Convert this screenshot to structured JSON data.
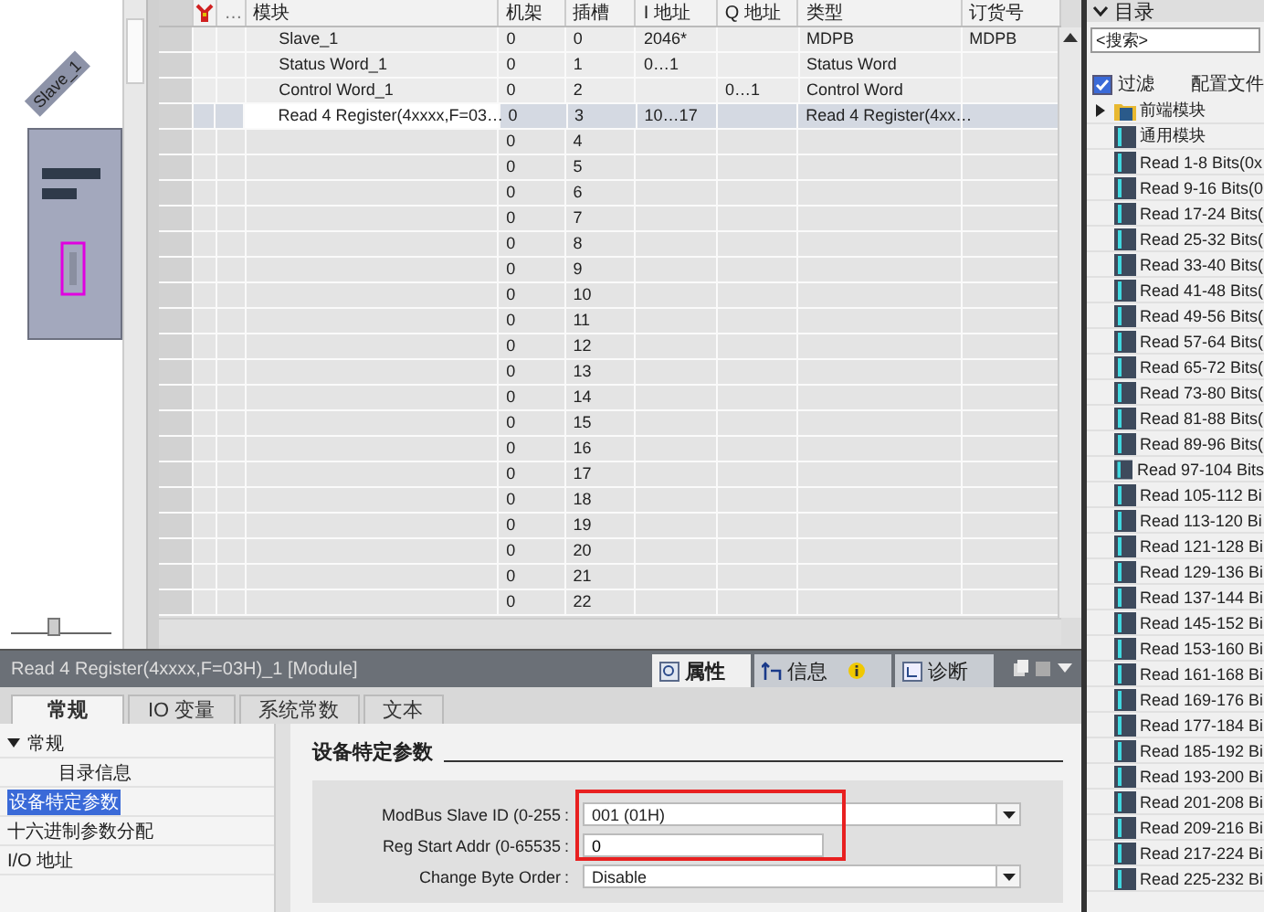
{
  "device_view": {
    "label": "Slave_1",
    "zoom": {
      "level": 0.4
    }
  },
  "table": {
    "columns": [
      "…",
      "模块",
      "机架",
      "插槽",
      "I 地址",
      "Q 地址",
      "类型",
      "订货号"
    ],
    "rows": [
      {
        "module": "Slave_1",
        "rack": "0",
        "slot": "0",
        "i_address": "2046*",
        "type": "MDPB",
        "order_no": "MDPB",
        "selected": false
      },
      {
        "module": "Status Word_1",
        "rack": "0",
        "slot": "1",
        "i_address": "0…1",
        "type": "Status Word",
        "selected": false
      },
      {
        "module": "Control Word_1",
        "rack": "0",
        "slot": "2",
        "q_address": "0…1",
        "type": "Control Word",
        "selected": false
      },
      {
        "module": "Read 4 Register(4xxxx,F=03…",
        "rack": "0",
        "slot": "3",
        "i_address": "10…17",
        "type": "Read 4 Register(4xx…",
        "selected": true
      },
      {
        "rack": "0",
        "slot": "4",
        "selected": false
      },
      {
        "rack": "0",
        "slot": "5",
        "selected": false
      },
      {
        "rack": "0",
        "slot": "6",
        "selected": false
      },
      {
        "rack": "0",
        "slot": "7",
        "selected": false
      },
      {
        "rack": "0",
        "slot": "8",
        "selected": false
      },
      {
        "rack": "0",
        "slot": "9",
        "selected": false
      },
      {
        "rack": "0",
        "slot": "10",
        "selected": false
      },
      {
        "rack": "0",
        "slot": "11",
        "selected": false
      },
      {
        "rack": "0",
        "slot": "12",
        "selected": false
      },
      {
        "rack": "0",
        "slot": "13",
        "selected": false
      },
      {
        "rack": "0",
        "slot": "14",
        "selected": false
      },
      {
        "rack": "0",
        "slot": "15",
        "selected": false
      },
      {
        "rack": "0",
        "slot": "16",
        "selected": false
      },
      {
        "rack": "0",
        "slot": "17",
        "selected": false
      },
      {
        "rack": "0",
        "slot": "18",
        "selected": false
      },
      {
        "rack": "0",
        "slot": "19",
        "selected": false
      },
      {
        "rack": "0",
        "slot": "20",
        "selected": false
      },
      {
        "rack": "0",
        "slot": "21",
        "selected": false
      },
      {
        "rack": "0",
        "slot": "22",
        "selected": false
      }
    ]
  },
  "properties": {
    "title": "Read 4 Register(4xxxx,F=03H)_1 [Module]",
    "view_tabs": [
      {
        "label": "属性",
        "kind": "properties",
        "selected": true
      },
      {
        "label": "信息",
        "kind": "info",
        "selected": false
      },
      {
        "label": "诊断",
        "kind": "diagnostics",
        "selected": false
      }
    ],
    "tabs": [
      {
        "label": "常规",
        "selected": true
      },
      {
        "label": "IO 变量",
        "selected": false
      },
      {
        "label": "系统常数",
        "selected": false
      },
      {
        "label": "文本",
        "selected": false
      }
    ],
    "nav": [
      {
        "label": "常规",
        "expanded": true,
        "selected": false,
        "children": [
          {
            "label": "目录信息",
            "selected": false
          }
        ]
      },
      {
        "label": "设备特定参数",
        "selected": true
      },
      {
        "label": "十六进制参数分配",
        "selected": false
      },
      {
        "label": "I/O 地址",
        "selected": false
      }
    ],
    "section_title": "设备特定参数",
    "highlight_box": true,
    "fields": [
      {
        "label": "ModBus Slave ID (0-255",
        "colon": ":",
        "kind": "dropdown",
        "value": "001 (01H)"
      },
      {
        "label": "Reg Start Addr (0-65535",
        "colon": ":",
        "kind": "input",
        "value": "0"
      },
      {
        "label": "Change Byte Order",
        "colon": ":",
        "kind": "dropdown",
        "value": "Disable"
      }
    ]
  },
  "catalog": {
    "title": "目录",
    "search": {
      "placeholder": "<搜索>"
    },
    "filter": {
      "label": "过滤",
      "checked": true
    },
    "profile_label": "配置文件",
    "items": [
      {
        "label": "前端模块",
        "kind": "folder",
        "expanded": false
      },
      {
        "label": "通用模块",
        "kind": "module"
      },
      {
        "label": "Read 1-8 Bits(0x",
        "kind": "module"
      },
      {
        "label": "Read 9-16 Bits(0",
        "kind": "module"
      },
      {
        "label": "Read 17-24 Bits(",
        "kind": "module"
      },
      {
        "label": "Read 25-32 Bits(",
        "kind": "module"
      },
      {
        "label": "Read 33-40 Bits(",
        "kind": "module"
      },
      {
        "label": "Read 41-48 Bits(",
        "kind": "module"
      },
      {
        "label": "Read 49-56 Bits(",
        "kind": "module"
      },
      {
        "label": "Read 57-64 Bits(",
        "kind": "module"
      },
      {
        "label": "Read 65-72 Bits(",
        "kind": "module"
      },
      {
        "label": "Read 73-80 Bits(",
        "kind": "module"
      },
      {
        "label": "Read 81-88 Bits(",
        "kind": "module"
      },
      {
        "label": "Read 89-96 Bits(",
        "kind": "module"
      },
      {
        "label": "Read 97-104 Bits",
        "kind": "module"
      },
      {
        "label": "Read 105-112 Bi",
        "kind": "module"
      },
      {
        "label": "Read 113-120 Bi",
        "kind": "module"
      },
      {
        "label": "Read 121-128 Bi",
        "kind": "module"
      },
      {
        "label": "Read 129-136 Bi",
        "kind": "module"
      },
      {
        "label": "Read 137-144 Bi",
        "kind": "module"
      },
      {
        "label": "Read 145-152 Bi",
        "kind": "module"
      },
      {
        "label": "Read 153-160 Bi",
        "kind": "module"
      },
      {
        "label": "Read 161-168 Bi",
        "kind": "module"
      },
      {
        "label": "Read 169-176 Bi",
        "kind": "module"
      },
      {
        "label": "Read 177-184 Bi",
        "kind": "module"
      },
      {
        "label": "Read 185-192 Bi",
        "kind": "module"
      },
      {
        "label": "Read 193-200 Bi",
        "kind": "module"
      },
      {
        "label": "Read 201-208 Bi",
        "kind": "module"
      },
      {
        "label": "Read 209-216 Bi",
        "kind": "module"
      },
      {
        "label": "Read 217-224 Bi",
        "kind": "module"
      },
      {
        "label": "Read 225-232 Bi",
        "kind": "module"
      }
    ]
  }
}
